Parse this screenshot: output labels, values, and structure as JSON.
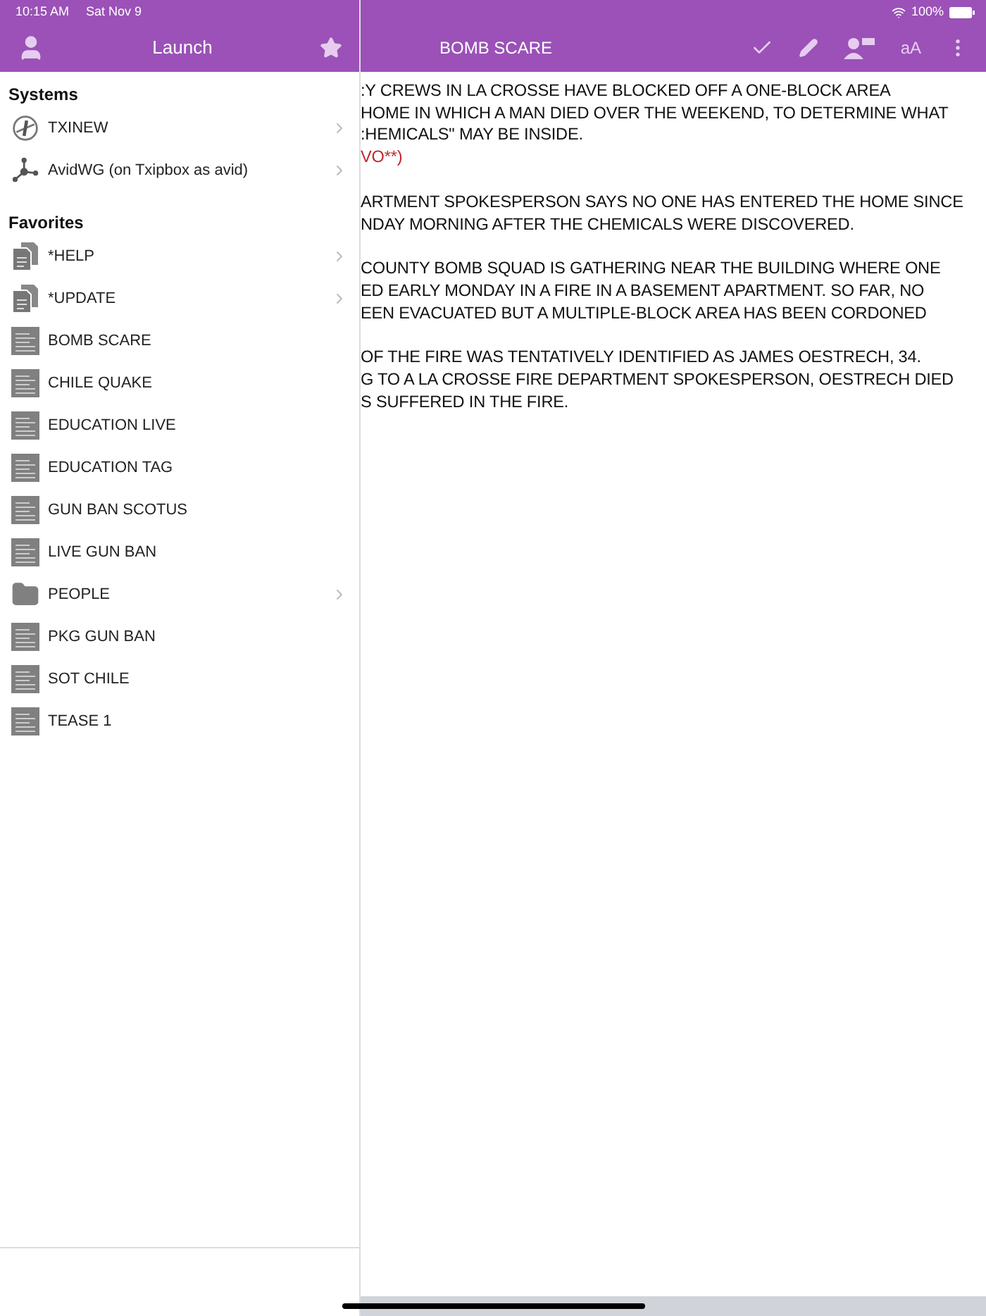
{
  "status_bar": {
    "time": "10:15 AM",
    "date": "Sat Nov 9",
    "battery": "100%"
  },
  "sidebar": {
    "title": "Launch",
    "sections": [
      {
        "heading": "Systems",
        "items": [
          {
            "label": "TXINEW",
            "kind": "server",
            "has_children": true
          },
          {
            "label": "AvidWG (on Txipbox as avid)",
            "kind": "network",
            "has_children": true
          }
        ]
      },
      {
        "heading": "Favorites",
        "items": [
          {
            "label": "*HELP",
            "kind": "queue",
            "has_children": true
          },
          {
            "label": "*UPDATE",
            "kind": "queue",
            "has_children": true
          },
          {
            "label": "BOMB SCARE",
            "kind": "story",
            "has_children": false
          },
          {
            "label": "CHILE QUAKE",
            "kind": "story",
            "has_children": false
          },
          {
            "label": "EDUCATION LIVE",
            "kind": "story",
            "has_children": false
          },
          {
            "label": "EDUCATION TAG",
            "kind": "story",
            "has_children": false
          },
          {
            "label": "GUN BAN SCOTUS",
            "kind": "story",
            "has_children": false
          },
          {
            "label": "LIVE GUN BAN",
            "kind": "story",
            "has_children": false
          },
          {
            "label": "PEOPLE",
            "kind": "folder",
            "has_children": true
          },
          {
            "label": "PKG GUN BAN",
            "kind": "story",
            "has_children": false
          },
          {
            "label": "SOT CHILE",
            "kind": "story",
            "has_children": false
          },
          {
            "label": "TEASE 1",
            "kind": "story",
            "has_children": false
          }
        ]
      }
    ]
  },
  "story": {
    "title": "BOMB SCARE",
    "toolbar_text": "aA",
    "paragraphs": [
      {
        "lines": [
          {
            "text": ":Y CREWS IN LA CROSSE HAVE BLOCKED OFF A ONE-BLOCK AREA",
            "kind": "body"
          },
          {
            "text": "HOME IN WHICH A MAN DIED OVER THE WEEKEND, TO DETERMINE WHAT",
            "kind": "body"
          },
          {
            "text": ":HEMICALS\" MAY BE INSIDE.",
            "kind": "body"
          },
          {
            "text": "VO**)",
            "kind": "instruction"
          }
        ]
      },
      {
        "lines": [
          {
            "text": "ARTMENT SPOKESPERSON SAYS NO ONE HAS ENTERED THE HOME SINCE",
            "kind": "body"
          },
          {
            "text": "NDAY MORNING AFTER THE CHEMICALS WERE DISCOVERED.",
            "kind": "body"
          }
        ]
      },
      {
        "lines": [
          {
            "text": "COUNTY BOMB SQUAD IS GATHERING NEAR THE BUILDING WHERE ONE",
            "kind": "body"
          },
          {
            "text": "ED EARLY MONDAY IN A FIRE IN A BASEMENT APARTMENT. SO FAR, NO",
            "kind": "body"
          },
          {
            "text": "EEN EVACUATED BUT A MULTIPLE-BLOCK AREA HAS BEEN CORDONED",
            "kind": "body"
          }
        ]
      },
      {
        "lines": [
          {
            "text": "OF THE FIRE WAS TENTATIVELY IDENTIFIED AS JAMES OESTRECH, 34.",
            "kind": "body"
          },
          {
            "text": "G TO A LA CROSSE FIRE DEPARTMENT SPOKESPERSON, OESTRECH DIED",
            "kind": "body"
          },
          {
            "text": "S SUFFERED IN THE FIRE.",
            "kind": "body"
          }
        ]
      }
    ]
  }
}
